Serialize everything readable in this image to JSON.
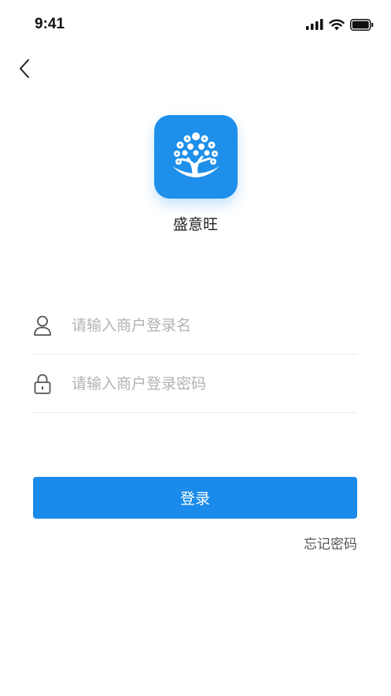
{
  "status_bar": {
    "time": "9:41"
  },
  "header": {
    "back_icon": "chevron-left-icon"
  },
  "brand": {
    "app_name": "盛意旺",
    "logo_color": "#1E8FEA",
    "logo_icon": "tree-logo-icon"
  },
  "form": {
    "username": {
      "value": "",
      "placeholder": "请输入商户登录名",
      "icon": "user-icon"
    },
    "password": {
      "value": "",
      "placeholder": "请输入商户登录密码",
      "icon": "lock-icon"
    },
    "login_label": "登录",
    "forgot_label": "忘记密码"
  },
  "colors": {
    "primary": "#1A8BEA",
    "placeholder": "#B3B3B3",
    "divider": "#ECECEC"
  }
}
